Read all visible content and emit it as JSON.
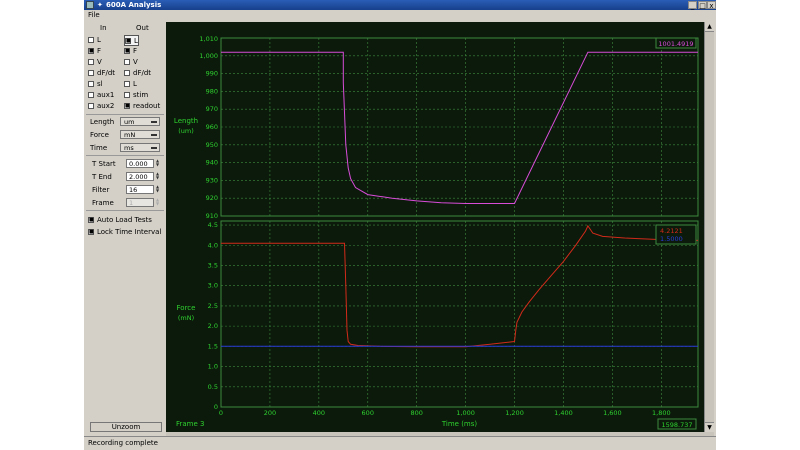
{
  "window": {
    "title": "600A Analysis",
    "buttons": {
      "minimize": "_",
      "maximize": "□",
      "close": "x"
    }
  },
  "menu": {
    "file": "File"
  },
  "channels": {
    "in_header": "In",
    "out_header": "Out",
    "in": [
      {
        "label": "L",
        "checked": false
      },
      {
        "label": "F",
        "checked": true
      },
      {
        "label": "V",
        "checked": false
      },
      {
        "label": "dF/dt",
        "checked": false
      },
      {
        "label": "sl",
        "checked": false
      },
      {
        "label": "aux1",
        "checked": false
      },
      {
        "label": "aux2",
        "checked": false
      }
    ],
    "out": [
      {
        "label": "L",
        "checked": true
      },
      {
        "label": "F",
        "checked": true
      },
      {
        "label": "V",
        "checked": false
      },
      {
        "label": "dF/dt",
        "checked": false
      },
      {
        "label": "L",
        "checked": false
      },
      {
        "label": "stim",
        "checked": false
      },
      {
        "label": "readout",
        "checked": true
      }
    ]
  },
  "units": {
    "length_label": "Length",
    "length_value": "um",
    "force_label": "Force",
    "force_value": "mN",
    "time_label": "Time",
    "time_value": "ms"
  },
  "params": {
    "tstart_label": "T Start",
    "tstart_value": "0.000",
    "tend_label": "T End",
    "tend_value": "2.000",
    "filter_label": "Filter",
    "filter_value": "16",
    "frame_label": "Frame",
    "frame_value": "1"
  },
  "options": {
    "auto_load": "Auto Load Tests",
    "lock_time": "Lock Time Interval"
  },
  "unzoom": "Unzoom",
  "status": "Recording complete",
  "colors": {
    "background": "#0b1a0b",
    "grid": "#3f8a3f",
    "axis_text": "#2fd12f",
    "length_trace": "#d84cd8",
    "force_trace": "#d22a1a",
    "baseline_trace": "#2a3ad8"
  },
  "chart_data": [
    {
      "type": "line",
      "ylabel": "Length",
      "yunit": "(um)",
      "ylim": [
        910,
        1010
      ],
      "yticks": [
        910,
        920,
        930,
        940,
        950,
        960,
        970,
        980,
        990,
        1000
      ],
      "ytick_labels": [
        "910",
        "920",
        "930",
        "940",
        "950",
        "960",
        "970",
        "980",
        "990",
        "1,000"
      ],
      "ytop_label": "1,010",
      "xlim": [
        0,
        1950
      ],
      "readout": "1001.4919",
      "series": [
        {
          "color": "#d84cd8",
          "x": [
            0,
            500,
            500,
            510,
            520,
            530,
            550,
            600,
            700,
            800,
            900,
            1000,
            1100,
            1200,
            1500,
            1950
          ],
          "y": [
            1002,
            1002,
            985,
            950,
            937,
            931,
            926,
            922,
            920,
            918.5,
            917.5,
            917,
            917,
            917,
            1002,
            1002
          ]
        }
      ]
    },
    {
      "type": "line",
      "ylabel": "Force",
      "yunit": "(mN)",
      "xlabel": "Time (ms)",
      "ylim": [
        0,
        4.6
      ],
      "yticks": [
        0,
        0.5,
        1.0,
        1.5,
        2.0,
        2.5,
        3.0,
        3.5,
        4.0,
        4.5
      ],
      "ytick_labels": [
        "0",
        "0.5",
        "1.0",
        "1.5",
        "2.0",
        "2.5",
        "3.0",
        "3.5",
        "4.0",
        "4.5"
      ],
      "xlim": [
        0,
        1950
      ],
      "xticks": [
        0,
        200,
        400,
        600,
        800,
        1000,
        1200,
        1400,
        1600,
        1800
      ],
      "xtick_labels": [
        "0",
        "200",
        "400",
        "600",
        "800",
        "1,000",
        "1,200",
        "1,400",
        "1,600",
        "1,800"
      ],
      "frame_label": "Frame 3",
      "readout_x": "1598.737",
      "readouts": [
        "4.2121",
        "1.5000"
      ],
      "series": [
        {
          "color": "#d22a1a",
          "x": [
            0,
            505,
            510,
            515,
            520,
            530,
            560,
            650,
            800,
            1000,
            1100,
            1200,
            1205,
            1210,
            1230,
            1260,
            1300,
            1350,
            1400,
            1450,
            1490,
            1500,
            1520,
            1560,
            1650,
            1800,
            1950
          ],
          "y": [
            4.05,
            4.05,
            3.0,
            1.9,
            1.62,
            1.55,
            1.52,
            1.5,
            1.49,
            1.49,
            1.55,
            1.62,
            1.9,
            2.1,
            2.35,
            2.6,
            2.9,
            3.25,
            3.6,
            4.0,
            4.35,
            4.48,
            4.3,
            4.22,
            4.18,
            4.14,
            4.12
          ]
        },
        {
          "color": "#2a3ad8",
          "x": [
            0,
            1950
          ],
          "y": [
            1.5,
            1.5
          ]
        }
      ]
    }
  ]
}
